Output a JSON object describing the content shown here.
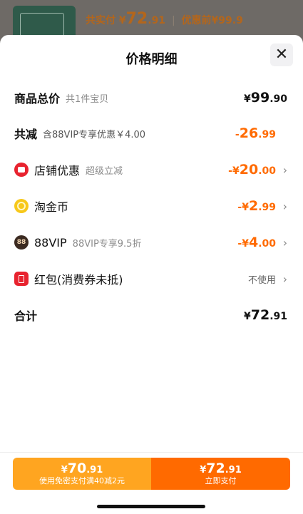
{
  "background": {
    "actual_pay_label": "共实付",
    "actual_pay_currency": "¥",
    "actual_pay_int": "72",
    "actual_pay_dec": ".91",
    "before_discount": "优惠前¥99.9"
  },
  "sheet": {
    "title": "价格明细",
    "close_icon": "close-icon"
  },
  "rows": {
    "total": {
      "label": "商品总价",
      "sub": "共1件宝贝",
      "cur": "¥",
      "int": "99",
      "dec": ".90"
    },
    "reduction": {
      "label": "共减",
      "sub": "含88VIP专享优惠￥4.00",
      "cur": "-",
      "int": "26",
      "dec": ".99"
    },
    "shop": {
      "icon": "shop-icon",
      "label": "店铺优惠",
      "sub": "超级立减",
      "cur": "-¥",
      "int": "20",
      "dec": ".00"
    },
    "coin": {
      "icon": "coin-icon",
      "label": "淘金币",
      "cur": "-¥",
      "int": "2",
      "dec": ".99"
    },
    "vip": {
      "icon": "vip-badge-icon",
      "icon_text": "88",
      "label": "88VIP",
      "sub": "88VIP专享9.5折",
      "cur": "-¥",
      "int": "4",
      "dec": ".00"
    },
    "redpacket": {
      "icon": "red-packet-icon",
      "label": "红包(消费券未抵)",
      "value": "不使用"
    },
    "sum": {
      "label": "合计",
      "cur": "¥",
      "int": "72",
      "dec": ".91"
    }
  },
  "footer": {
    "left": {
      "cur": "¥",
      "int": "70",
      "dec": ".91",
      "note": "使用免密支付满40减2元"
    },
    "right": {
      "cur": "¥",
      "int": "72",
      "dec": ".91",
      "note": "立即支付"
    }
  },
  "colors": {
    "accent": "#ff6a00",
    "secondary": "#ffa520"
  }
}
